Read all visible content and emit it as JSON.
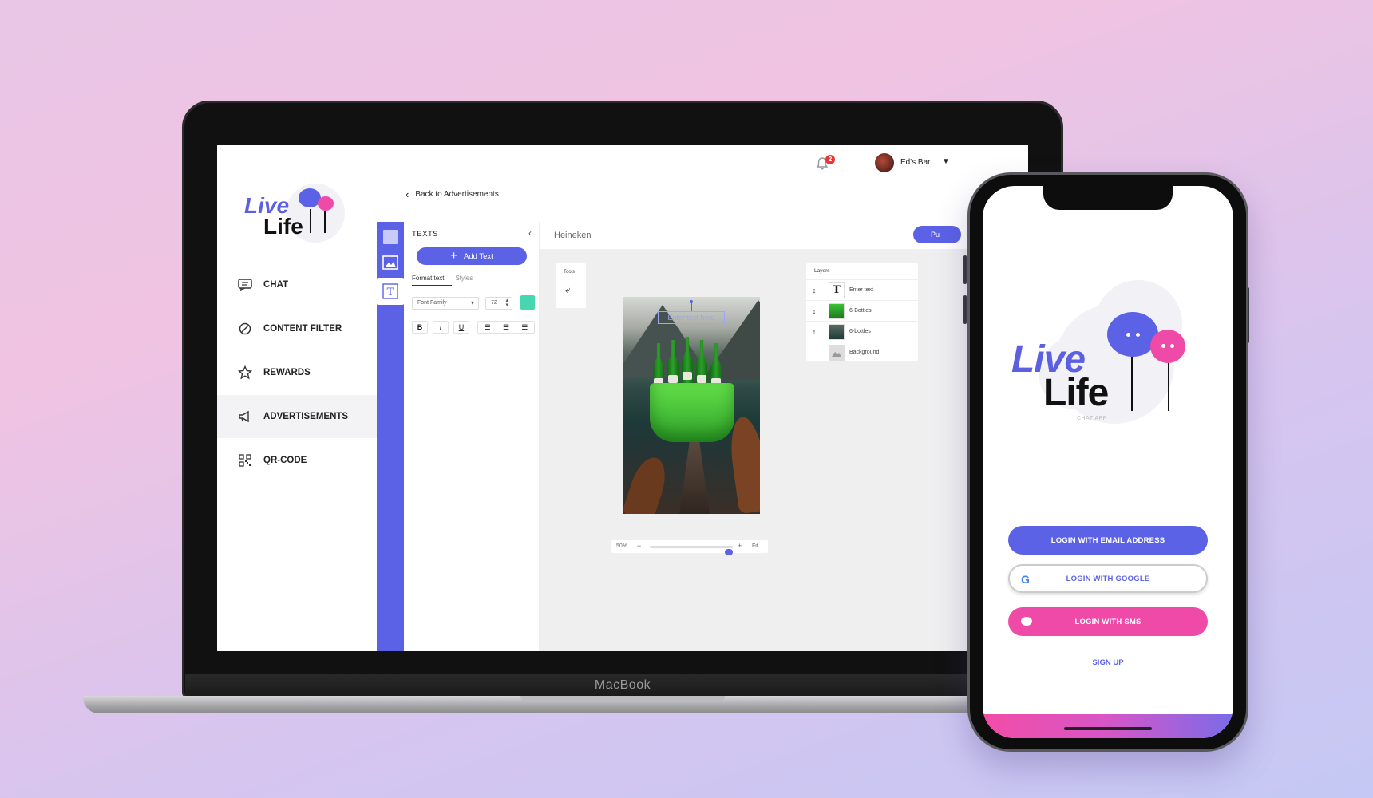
{
  "laptop": {
    "brand_label": "MacBook",
    "sidebar": {
      "logo_live": "Live",
      "logo_life": "Life",
      "items": [
        {
          "label": "CHAT",
          "icon": "chat-icon"
        },
        {
          "label": "CONTENT FILTER",
          "icon": "block-icon"
        },
        {
          "label": "REWARDS",
          "icon": "star-icon"
        },
        {
          "label": "ADVERTISEMENTS",
          "icon": "megaphone-icon",
          "active": true
        },
        {
          "label": "QR-CODE",
          "icon": "qr-code-icon"
        }
      ]
    },
    "header": {
      "notification_count": "2",
      "user_name": "Ed's Bar",
      "back_label": "Back to Advertisements"
    },
    "text_panel": {
      "title": "TEXTS",
      "add_text_label": "Add Text",
      "tabs": [
        "Format text",
        "Styles"
      ],
      "font_family_placeholder": "Font Family",
      "font_size": "72",
      "color": "#48d6b0",
      "format_buttons": [
        "B",
        "I",
        "U"
      ]
    },
    "editor": {
      "ad_name": "Heineken",
      "publish_label": "Pu",
      "tools_label": "Tools",
      "text_placeholder": "Enter text here",
      "zoom": "50%",
      "zoom_minus": "−",
      "zoom_plus": "+",
      "fit_label": "Fit",
      "zoom_level": 0.5
    },
    "layers": {
      "title": "Layers",
      "items": [
        {
          "name": "Enter text",
          "thumb": "T"
        },
        {
          "name": "6-Bottles",
          "thumb": ""
        },
        {
          "name": "6-bottles",
          "thumb": ""
        },
        {
          "name": "Background",
          "thumb": ""
        }
      ]
    }
  },
  "phone": {
    "logo_live": "Live",
    "logo_life": "Life",
    "logo_tagline": "CHAT APP",
    "buttons": {
      "email": "LOGIN WITH EMAIL ADDRESS",
      "google": "LOGIN WITH GOOGLE",
      "sms": "LOGIN WITH SMS"
    },
    "google_glyph": "G",
    "signup": "SIGN UP"
  },
  "colors": {
    "brand_blue": "#5b62e6",
    "brand_pink": "#f04aa9"
  }
}
